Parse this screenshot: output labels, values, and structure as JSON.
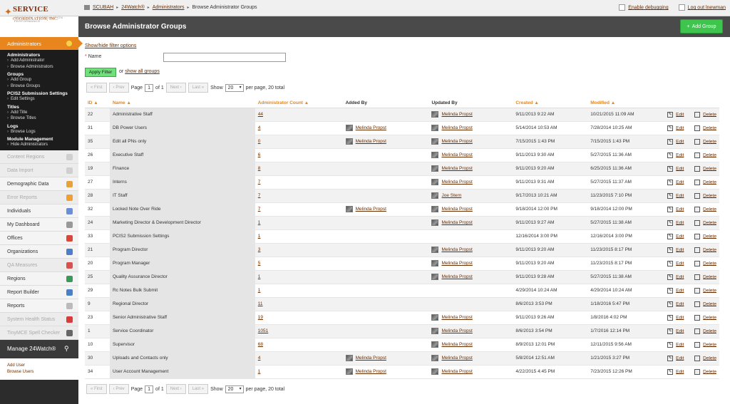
{
  "header": {
    "logo_name": "SERVICE",
    "logo_suffix": "COORDINATION, INC.",
    "logo_tagline": "ADVOCACY · COORDINATION · PERFORMANCE",
    "breadcrumbs": [
      "SCUBAH",
      "24Watch®",
      "Administrators",
      "Browse Administrator Groups"
    ],
    "enable_debugging": "Enable debugging",
    "logout": "Log out lnewman"
  },
  "page": {
    "title": "Browse Administrator Groups",
    "add_button": "Add Group"
  },
  "sidebar": {
    "active": "Administrators",
    "submenu": [
      {
        "heading": "Administrators",
        "links": [
          "Add Administrator",
          "Browse Administrators"
        ]
      },
      {
        "heading": "Groups",
        "links": [
          "Add Group",
          "Browse Groups"
        ]
      },
      {
        "heading": "PCIS2 Submission Settings",
        "links": [
          "Edit Settings"
        ]
      },
      {
        "heading": "Titles",
        "links": [
          "Add Title",
          "Browse Titles"
        ]
      },
      {
        "heading": "Logs",
        "links": [
          "Browse Logs"
        ]
      },
      {
        "heading": "Module Management",
        "links": [
          "Hide Administrators"
        ]
      }
    ],
    "modules": [
      {
        "label": "Content Regions",
        "dim": true,
        "color": "#cfcfcf"
      },
      {
        "label": "Data Import",
        "dim": true,
        "color": "#cfcfcf"
      },
      {
        "label": "Demographic Data",
        "dim": false,
        "color": "#e8a23a"
      },
      {
        "label": "Error Reports",
        "dim": true,
        "color": "#f0a030"
      },
      {
        "label": "Individuals",
        "dim": false,
        "color": "#6a8fd8"
      },
      {
        "label": "My Dashboard",
        "dim": false,
        "color": "#999999"
      },
      {
        "label": "Offices",
        "dim": false,
        "color": "#d9463a"
      },
      {
        "label": "Organizations",
        "dim": false,
        "color": "#4a7fd0"
      },
      {
        "label": "QA Measures",
        "dim": true,
        "color": "#d95050"
      },
      {
        "label": "Regions",
        "dim": false,
        "color": "#3a9a5a"
      },
      {
        "label": "Report Builder",
        "dim": false,
        "color": "#4a80c8"
      },
      {
        "label": "Reports",
        "dim": false,
        "color": "#bbbbbb"
      },
      {
        "label": "System Health Status",
        "dim": true,
        "color": "#d93a3a"
      },
      {
        "label": "TinyMCE Spell Checker",
        "dim": true,
        "color": "#666666"
      }
    ],
    "manage": "Manage 24Watch®",
    "footer_links": [
      "Add User",
      "Browse Users"
    ]
  },
  "filter": {
    "toggle": "Show/hide filter options",
    "name_label": "Name",
    "name_value": "",
    "apply": "Apply Filter",
    "or": "or",
    "show_all": "show all groups"
  },
  "pagination": {
    "first": "« First",
    "prev": "‹ Prev",
    "page_label": "Page",
    "page": "1",
    "of": "of 1",
    "next": "Next ›",
    "last": "Last »",
    "show": "Show",
    "per_page": "20",
    "per_page_suffix": "per page, 20 total"
  },
  "table": {
    "columns": [
      "ID ▲",
      "Name ▲",
      "Administrator Count ▲",
      "Added By",
      "Updated By",
      "Created ▲",
      "Modified ▲"
    ],
    "edit": "Edit",
    "delete": "Delete",
    "rows": [
      {
        "id": "22",
        "name": "Administrative Staff",
        "count": "44",
        "added": "",
        "updated": "Melinda Propst",
        "created": "9/11/2013 9:22 AM",
        "modified": "10/21/2015 11:09 AM"
      },
      {
        "id": "31",
        "name": "DB Power Users",
        "count": "4",
        "added": "Melinda Propst",
        "updated": "Melinda Propst",
        "created": "5/14/2014 10:53 AM",
        "modified": "7/28/2014 10:25 AM"
      },
      {
        "id": "35",
        "name": "Edit all PNs only",
        "count": "0",
        "added": "Melinda Propst",
        "updated": "Melinda Propst",
        "created": "7/15/2015 1:43 PM",
        "modified": "7/15/2015 1:43 PM"
      },
      {
        "id": "26",
        "name": "Executive Staff",
        "count": "6",
        "added": "",
        "updated": "Melinda Propst",
        "created": "9/11/2013 9:30 AM",
        "modified": "5/27/2015 11:36 AM"
      },
      {
        "id": "19",
        "name": "Finance",
        "count": "8",
        "added": "",
        "updated": "Melinda Propst",
        "created": "9/11/2013 9:20 AM",
        "modified": "6/25/2015 11:36 AM"
      },
      {
        "id": "27",
        "name": "Interns",
        "count": "7",
        "added": "",
        "updated": "Melinda Propst",
        "created": "9/11/2013 9:31 AM",
        "modified": "5/27/2015 11:37 AM"
      },
      {
        "id": "28",
        "name": "IT Staff",
        "count": "7",
        "added": "",
        "updated": "Joe Stern",
        "created": "9/17/2013 10:21 AM",
        "modified": "11/23/2015 7:10 PM"
      },
      {
        "id": "32",
        "name": "Locked Note Over Ride",
        "count": "7",
        "added": "Melinda Propst",
        "updated": "Melinda Propst",
        "created": "9/18/2014 12:00 PM",
        "modified": "9/18/2014 12:00 PM"
      },
      {
        "id": "24",
        "name": "Marketing Director & Development Director",
        "count": "1",
        "added": "",
        "updated": "Melinda Propst",
        "created": "9/11/2013 9:27 AM",
        "modified": "5/27/2015 11:38 AM"
      },
      {
        "id": "33",
        "name": "PCIS2 Submission Settings",
        "count": "1",
        "added": "",
        "updated": "",
        "created": "12/16/2014 3:00 PM",
        "modified": "12/16/2014 3:00 PM"
      },
      {
        "id": "21",
        "name": "Program Director",
        "count": "3",
        "added": "",
        "updated": "Melinda Propst",
        "created": "9/11/2013 9:20 AM",
        "modified": "11/23/2015 8:17 PM"
      },
      {
        "id": "20",
        "name": "Program Manager",
        "count": "5",
        "added": "",
        "updated": "Melinda Propst",
        "created": "9/11/2013 9:20 AM",
        "modified": "11/23/2015 8:17 PM"
      },
      {
        "id": "25",
        "name": "Quality Assurance Director",
        "count": "1",
        "added": "",
        "updated": "Melinda Propst",
        "created": "9/11/2013 9:28 AM",
        "modified": "5/27/2015 11:38 AM"
      },
      {
        "id": "29",
        "name": "Rc Notes Bulk Submit",
        "count": "1",
        "added": "",
        "updated": "",
        "created": "4/29/2014 10:24 AM",
        "modified": "4/29/2014 10:24 AM"
      },
      {
        "id": "9",
        "name": "Regional Director",
        "count": "11",
        "added": "",
        "updated": "",
        "created": "8/6/2013 3:53 PM",
        "modified": "1/18/2016 5:47 PM"
      },
      {
        "id": "23",
        "name": "Senior Administrative Staff",
        "count": "19",
        "added": "",
        "updated": "Melinda Propst",
        "created": "9/11/2013 9:26 AM",
        "modified": "1/8/2016 4:02 PM"
      },
      {
        "id": "1",
        "name": "Service Coordinator",
        "count": "1051",
        "added": "",
        "updated": "Melinda Propst",
        "created": "8/6/2013 3:54 PM",
        "modified": "1/7/2016 12:14 PM"
      },
      {
        "id": "10",
        "name": "Supervisor",
        "count": "68",
        "added": "",
        "updated": "Melinda Propst",
        "created": "8/9/2013 12:01 PM",
        "modified": "12/11/2015 9:56 AM"
      },
      {
        "id": "30",
        "name": "Uploads and Contacts only",
        "count": "4",
        "added": "Melinda Propst",
        "updated": "Melinda Propst",
        "created": "5/8/2014 12:51 AM",
        "modified": "1/21/2015 3:27 PM"
      },
      {
        "id": "34",
        "name": "User Account Management",
        "count": "1",
        "added": "Melinda Propst",
        "updated": "Melinda Propst",
        "created": "4/22/2015 4:45 PM",
        "modified": "7/23/2015 12:26 PM"
      }
    ]
  }
}
